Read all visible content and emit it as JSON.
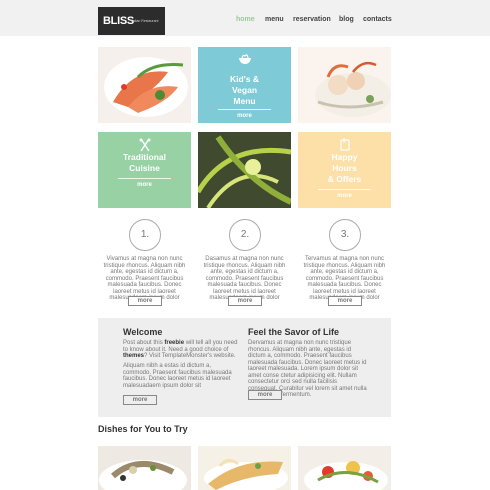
{
  "header": {
    "logo_brand": "BLISS",
    "logo_tagline": "Italian Restaurant",
    "nav": [
      "home",
      "menu",
      "reservation",
      "blog",
      "contacts"
    ]
  },
  "tiles": {
    "vegan": {
      "title_1": "Kid's &",
      "title_2": "Vegan",
      "title_3": "Menu",
      "more": "more",
      "color": "#7ecad6"
    },
    "traditional": {
      "title_1": "Traditional",
      "title_2": "Cuisine",
      "more": "more",
      "color": "#98d2a4"
    },
    "happy_hours": {
      "title_1": "Happy",
      "title_2": "Hours",
      "title_3": "& Offers",
      "more": "more",
      "color": "#fddfa8"
    }
  },
  "columns": [
    {
      "number": "1.",
      "text": "Vivamus at magna non nunc tristique rhoncus. Aliquam nibh ante, egestas id dictum a, commodo. Praesent faucibus malesuada faucibus. Donec laoreet metus id laoreet malesuadaem ipsum dolor",
      "more": "more"
    },
    {
      "number": "2.",
      "text": "Dasamus at magna non nunc tristique rhoncus. Aliquam nibh ante, egestas id dictum a, commodo. Praesent faucibus malesuada faucibus. Donec laoreet metus id laoreet malesuadaem ipsum dolor",
      "more": "more"
    },
    {
      "number": "3.",
      "text": "Tervamus at magna non nunc tristique rhoncus. Aliquam nibh ante, egestas id dictum a, commodo. Praesent faucibus malesuada faucibus. Donec laoreet metus id laoreet malesuadaem ipsum dolor",
      "more": "more"
    }
  ],
  "welcome": {
    "title": "Welcome",
    "p1_pre": "Post about this ",
    "p1_link1": "freebie",
    "p1_mid": " will tell all you need to know about it. Need a good choice of ",
    "p1_link2": "themes",
    "p1_post": "? Visit TemplateMonster's website.",
    "p2": "Aliquam nibh a estas id dictum a, commodo. Praesent faucibus malesuada faucibus. Donec laoreet metus id laoreet malesuadaem ipsum dolor sit",
    "more": "more"
  },
  "savor": {
    "title": "Feel the Savor of Life",
    "p1": "Dervamus at magna non nunc tristique rhoncus. Aliquam nibh ante, egestas id dictum a, commodo. Praesent faucibus malesuada faucibus. Donec laoreet metus id laoreet malesuada. Lorem ipsum dolor sit amet conse ctetur adipisicing elit. Nullam consectetur orci sed nulla facilisis consequat. Curabitur vel lorem sit amet nulla ullamcorper fermentum.",
    "more": "more"
  },
  "dishes": {
    "title": "Dishes for You to Try"
  }
}
